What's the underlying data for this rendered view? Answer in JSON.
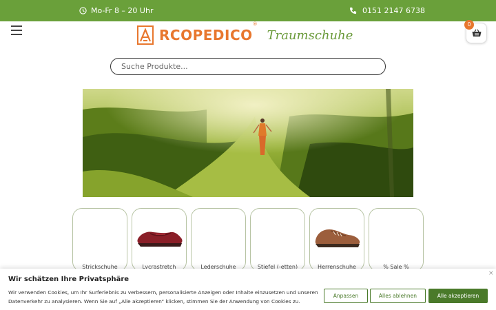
{
  "topbar": {
    "hours_icon": "clock-icon",
    "hours": "Mo-Fr 8 – 20 Uhr",
    "phone_icon": "phone-icon",
    "phone": "0151 2147 6738"
  },
  "header": {
    "menu_icon": "hamburger-menu-icon",
    "logo_brand": "RCOPEDICO",
    "logo_reg": "®",
    "logo_subtitle": "Traumschuhe",
    "cart_icon": "basket-icon",
    "cart_count": "0"
  },
  "search": {
    "placeholder": "Suche Produkte..."
  },
  "categories": [
    {
      "label": "Strickschuhe",
      "image": ""
    },
    {
      "label": "Lycrastretch",
      "image": "red-shoe"
    },
    {
      "label": "Lederschuhe",
      "image": ""
    },
    {
      "label": "Stiefel (-etten)",
      "image": ""
    },
    {
      "label": "Herrenschuhe",
      "image": "brown-shoe"
    },
    {
      "label": "% Sale %",
      "image": ""
    }
  ],
  "cookie": {
    "title": "Wir schätzen Ihre Privatsphäre",
    "text": "Wir verwenden Cookies, um Ihr Surferlebnis zu verbessern, personalisierte Anzeigen oder Inhalte einzusetzen und unseren Datenverkehr zu analysieren. Wenn Sie auf „Alle akzeptieren“ klicken, stimmen Sie der Anwendung von Cookies zu.",
    "close": "×",
    "btn_customize": "Anpassen",
    "btn_reject": "Alles ablehnen",
    "btn_accept": "Alle akzeptieren"
  },
  "colors": {
    "topbar": "#6aa03a",
    "brand_orange": "#e8772e",
    "brand_green": "#4a7a2a"
  }
}
